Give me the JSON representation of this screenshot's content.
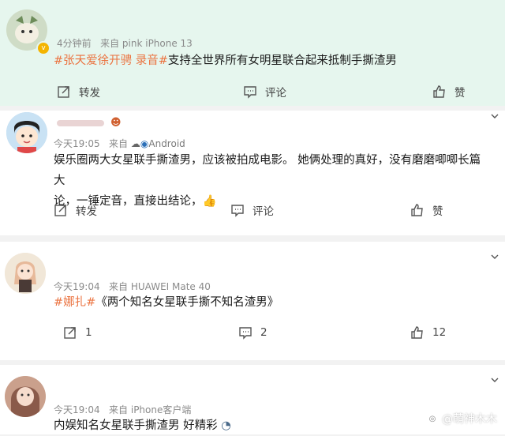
{
  "posts": [
    {
      "meta_time": "4分钟前",
      "meta_source": "来自 pink iPhone 13",
      "tags": [
        "#张天爱徐开骋 录音#"
      ],
      "text": "支持全世界所有女明星联合起来抵制手撕渣男",
      "actions": {
        "repost": "转发",
        "comment": "评论",
        "like": "赞"
      }
    },
    {
      "meta_time": "今天19:05",
      "meta_source_prefix": "来自",
      "meta_source_brand": "Android",
      "text_line1": "娱乐圈两大女星联手撕渣男，应该被拍成电影。 她俩处理的真好，没有磨磨唧唧长篇大",
      "text_line2": "论，一锤定音，直接出结论，",
      "actions": {
        "repost": "转发",
        "comment": "评论",
        "like": "赞"
      }
    },
    {
      "meta_time": "今天19:04",
      "meta_source": "来自 HUAWEI Mate 40",
      "tag": "#娜扎#",
      "text": "《两个知名女星联手撕不知名渣男》",
      "actions": {
        "repost": "1",
        "comment": "2",
        "like": "12"
      }
    },
    {
      "meta_time": "今天19:04",
      "meta_source": "来自 iPhone客户端",
      "text": "内娱知名女星联手撕渣男 好精彩"
    }
  ],
  "watermark": "@萌神木木",
  "colors": {
    "tag": "#eb7340",
    "post1_bg": "#e6f6ee",
    "separator": "#f2f2f2"
  }
}
